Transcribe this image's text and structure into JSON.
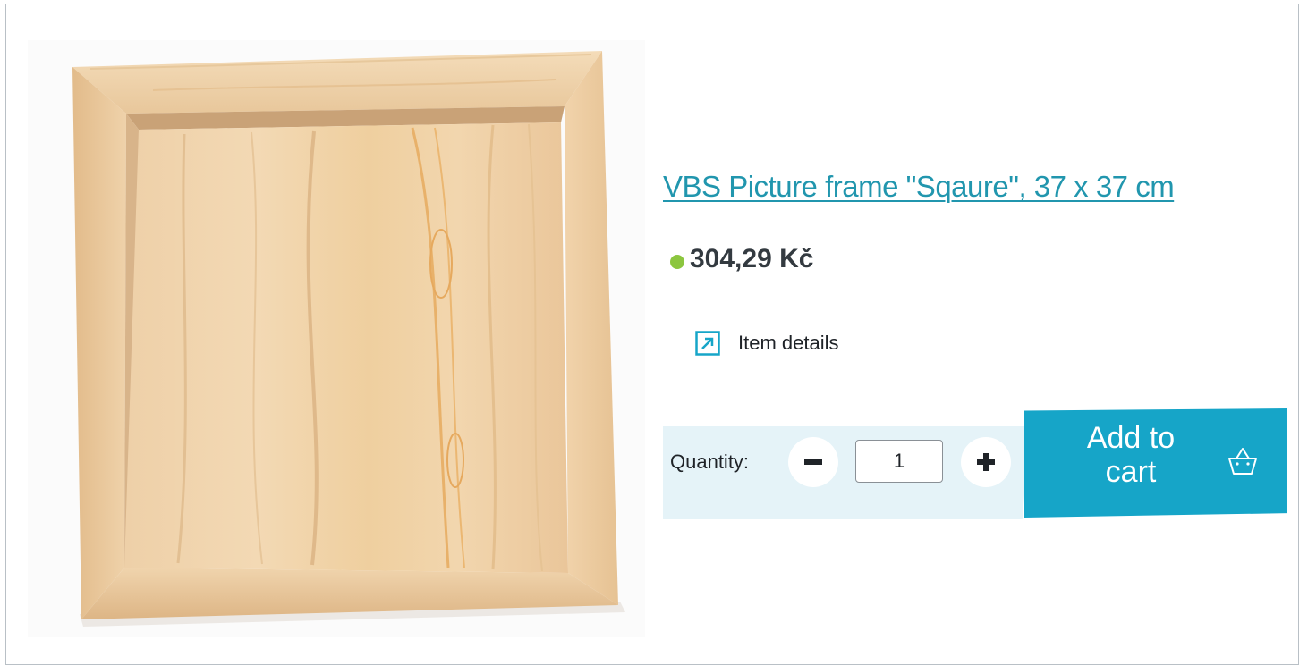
{
  "product": {
    "title": "VBS Picture frame \"Sqaure\", 37 x 37 cm",
    "price": "304,29 Kč",
    "stock_status_color": "#8cc63f",
    "details_label": "Item details",
    "details_icon": "external-link-icon",
    "image_alt": "Wooden square picture frame"
  },
  "quantity": {
    "label": "Quantity:",
    "value": "1",
    "decrement_icon": "minus-icon",
    "increment_icon": "plus-icon"
  },
  "cart": {
    "button_label": "Add to cart",
    "icon": "basket-icon"
  },
  "colors": {
    "accent": "#16a5c8",
    "link": "#2196ae",
    "band": "#e5f3f8",
    "text": "#1f2328"
  }
}
